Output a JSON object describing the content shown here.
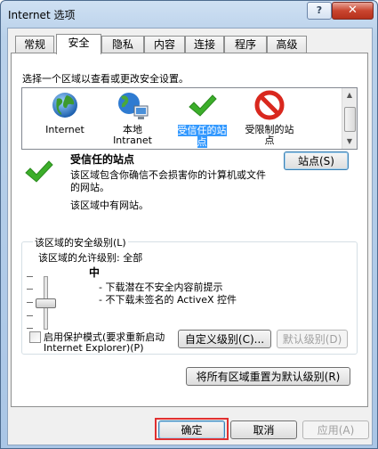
{
  "window": {
    "title": "Internet 选项",
    "help_glyph": "?",
    "close_glyph": "✕"
  },
  "tabs": [
    {
      "label": "常规"
    },
    {
      "label": "安全"
    },
    {
      "label": "隐私"
    },
    {
      "label": "内容"
    },
    {
      "label": "连接"
    },
    {
      "label": "程序"
    },
    {
      "label": "高级"
    }
  ],
  "active_tab": "安全",
  "security": {
    "zone_prompt": "选择一个区域以查看或更改安全设置。",
    "zones": [
      {
        "icon": "globe-icon",
        "label_line1": "Internet",
        "label_line2": ""
      },
      {
        "icon": "local-intranet-icon",
        "label_line1": "本地",
        "label_line2": "Intranet"
      },
      {
        "icon": "checkmark-icon",
        "label_line1": "受信任的站",
        "label_line2": "点"
      },
      {
        "icon": "no-entry-icon",
        "label_line1": "受限制的站",
        "label_line2": "点"
      }
    ],
    "selected_zone": "受信任的站点",
    "zone_title": "受信任的站点",
    "zone_desc_line1": "该区域包含你确信不会损害你的计算机或文件",
    "zone_desc_line2": "的网站。",
    "zone_status": "该区域中有网站。",
    "sites_button": "站点(S)",
    "level_group_label": "该区域的安全级别(L)",
    "allowed_levels": "该区域的允许级别: 全部",
    "level_name": "中",
    "level_bullet1": "- 下载潜在不安全内容前提示",
    "level_bullet2": "- 不下载未签名的 ActiveX 控件",
    "slider_level_index": 2,
    "protected_mode_line1": "启用保护模式(要求重新启动",
    "protected_mode_line2": "Internet Explorer)(P)",
    "protected_mode_checked": false,
    "custom_level_button": "自定义级别(C)...",
    "default_level_button": "默认级别(D)",
    "reset_all_button": "将所有区域重置为默认级别(R)"
  },
  "footer": {
    "ok": "确定",
    "cancel": "取消",
    "apply": "应用(A)"
  },
  "colors": {
    "selection": "#3399ff",
    "check_green": "#3cae2a",
    "no_entry_red": "#d9281e",
    "ok_highlight": "#e03030"
  }
}
